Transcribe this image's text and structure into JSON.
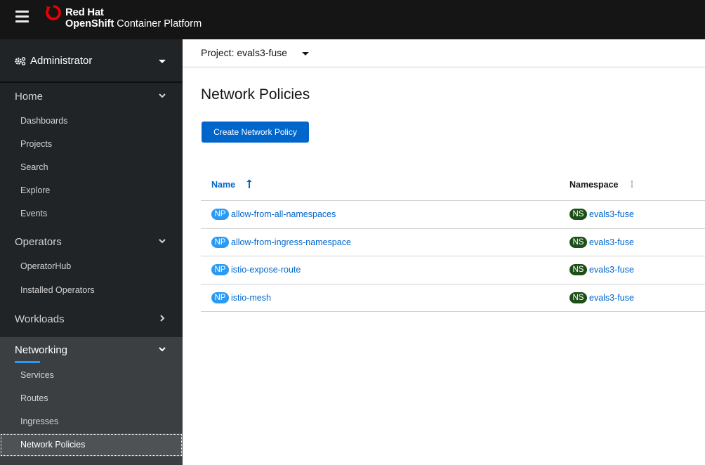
{
  "masthead": {
    "brand_top": "Red Hat",
    "brand_product_bold": "OpenShift",
    "brand_product_rest": " Container Platform",
    "menu_icon": "hamburger-icon",
    "logo_icon": "redhat-logo-icon"
  },
  "sidebar": {
    "perspective": {
      "label": "Administrator",
      "icon": "cogs-icon"
    },
    "sections": [
      {
        "label": "Home",
        "expanded": true,
        "items": [
          "Dashboards",
          "Projects",
          "Search",
          "Explore",
          "Events"
        ]
      },
      {
        "label": "Operators",
        "expanded": true,
        "items": [
          "OperatorHub",
          "Installed Operators"
        ]
      },
      {
        "label": "Workloads",
        "expanded": false,
        "items": []
      },
      {
        "label": "Networking",
        "expanded": true,
        "active": true,
        "items": [
          "Services",
          "Routes",
          "Ingresses",
          "Network Policies"
        ],
        "current_item": "Network Policies"
      }
    ]
  },
  "project_bar": {
    "label": "Project: evals3-fuse"
  },
  "page": {
    "title": "Network Policies",
    "create_button": "Create Network Policy"
  },
  "table": {
    "columns": [
      {
        "label": "Name",
        "sort": "ascending"
      },
      {
        "label": "Namespace",
        "sort": "none"
      }
    ],
    "rows": [
      {
        "kind_badge": "NP",
        "name": "allow-from-all-namespaces",
        "ns_badge": "NS",
        "namespace": "evals3-fuse"
      },
      {
        "kind_badge": "NP",
        "name": "allow-from-ingress-namespace",
        "ns_badge": "NS",
        "namespace": "evals3-fuse"
      },
      {
        "kind_badge": "NP",
        "name": "istio-expose-route",
        "ns_badge": "NS",
        "namespace": "evals3-fuse"
      },
      {
        "kind_badge": "NP",
        "name": "istio-mesh",
        "ns_badge": "NS",
        "namespace": "evals3-fuse"
      }
    ]
  },
  "colors": {
    "masthead_bg": "#151515",
    "sidebar_bg": "#212427",
    "sidebar_active_bg": "#3c3f42",
    "accent": "#2b9af3",
    "link": "#0066cc",
    "primary_button": "#0066cc",
    "np_badge": "#2b9af3",
    "ns_badge": "#1e4f18"
  }
}
